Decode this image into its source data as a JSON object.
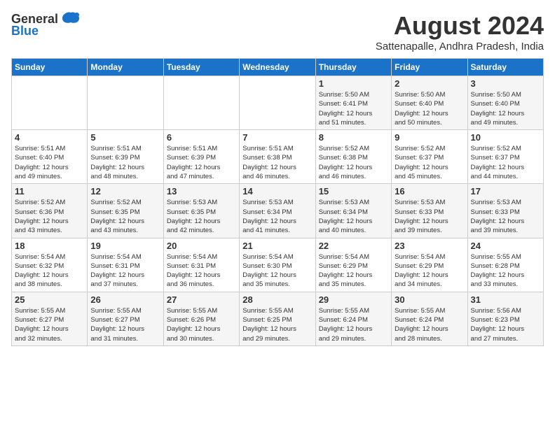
{
  "logo": {
    "general": "General",
    "blue": "Blue"
  },
  "header": {
    "month_year": "August 2024",
    "location": "Sattenapalle, Andhra Pradesh, India"
  },
  "days_of_week": [
    "Sunday",
    "Monday",
    "Tuesday",
    "Wednesday",
    "Thursday",
    "Friday",
    "Saturday"
  ],
  "weeks": [
    [
      {
        "day": "",
        "info": ""
      },
      {
        "day": "",
        "info": ""
      },
      {
        "day": "",
        "info": ""
      },
      {
        "day": "",
        "info": ""
      },
      {
        "day": "1",
        "info": "Sunrise: 5:50 AM\nSunset: 6:41 PM\nDaylight: 12 hours\nand 51 minutes."
      },
      {
        "day": "2",
        "info": "Sunrise: 5:50 AM\nSunset: 6:40 PM\nDaylight: 12 hours\nand 50 minutes."
      },
      {
        "day": "3",
        "info": "Sunrise: 5:50 AM\nSunset: 6:40 PM\nDaylight: 12 hours\nand 49 minutes."
      }
    ],
    [
      {
        "day": "4",
        "info": "Sunrise: 5:51 AM\nSunset: 6:40 PM\nDaylight: 12 hours\nand 49 minutes."
      },
      {
        "day": "5",
        "info": "Sunrise: 5:51 AM\nSunset: 6:39 PM\nDaylight: 12 hours\nand 48 minutes."
      },
      {
        "day": "6",
        "info": "Sunrise: 5:51 AM\nSunset: 6:39 PM\nDaylight: 12 hours\nand 47 minutes."
      },
      {
        "day": "7",
        "info": "Sunrise: 5:51 AM\nSunset: 6:38 PM\nDaylight: 12 hours\nand 46 minutes."
      },
      {
        "day": "8",
        "info": "Sunrise: 5:52 AM\nSunset: 6:38 PM\nDaylight: 12 hours\nand 46 minutes."
      },
      {
        "day": "9",
        "info": "Sunrise: 5:52 AM\nSunset: 6:37 PM\nDaylight: 12 hours\nand 45 minutes."
      },
      {
        "day": "10",
        "info": "Sunrise: 5:52 AM\nSunset: 6:37 PM\nDaylight: 12 hours\nand 44 minutes."
      }
    ],
    [
      {
        "day": "11",
        "info": "Sunrise: 5:52 AM\nSunset: 6:36 PM\nDaylight: 12 hours\nand 43 minutes."
      },
      {
        "day": "12",
        "info": "Sunrise: 5:52 AM\nSunset: 6:35 PM\nDaylight: 12 hours\nand 43 minutes."
      },
      {
        "day": "13",
        "info": "Sunrise: 5:53 AM\nSunset: 6:35 PM\nDaylight: 12 hours\nand 42 minutes."
      },
      {
        "day": "14",
        "info": "Sunrise: 5:53 AM\nSunset: 6:34 PM\nDaylight: 12 hours\nand 41 minutes."
      },
      {
        "day": "15",
        "info": "Sunrise: 5:53 AM\nSunset: 6:34 PM\nDaylight: 12 hours\nand 40 minutes."
      },
      {
        "day": "16",
        "info": "Sunrise: 5:53 AM\nSunset: 6:33 PM\nDaylight: 12 hours\nand 39 minutes."
      },
      {
        "day": "17",
        "info": "Sunrise: 5:53 AM\nSunset: 6:33 PM\nDaylight: 12 hours\nand 39 minutes."
      }
    ],
    [
      {
        "day": "18",
        "info": "Sunrise: 5:54 AM\nSunset: 6:32 PM\nDaylight: 12 hours\nand 38 minutes."
      },
      {
        "day": "19",
        "info": "Sunrise: 5:54 AM\nSunset: 6:31 PM\nDaylight: 12 hours\nand 37 minutes."
      },
      {
        "day": "20",
        "info": "Sunrise: 5:54 AM\nSunset: 6:31 PM\nDaylight: 12 hours\nand 36 minutes."
      },
      {
        "day": "21",
        "info": "Sunrise: 5:54 AM\nSunset: 6:30 PM\nDaylight: 12 hours\nand 35 minutes."
      },
      {
        "day": "22",
        "info": "Sunrise: 5:54 AM\nSunset: 6:29 PM\nDaylight: 12 hours\nand 35 minutes."
      },
      {
        "day": "23",
        "info": "Sunrise: 5:54 AM\nSunset: 6:29 PM\nDaylight: 12 hours\nand 34 minutes."
      },
      {
        "day": "24",
        "info": "Sunrise: 5:55 AM\nSunset: 6:28 PM\nDaylight: 12 hours\nand 33 minutes."
      }
    ],
    [
      {
        "day": "25",
        "info": "Sunrise: 5:55 AM\nSunset: 6:27 PM\nDaylight: 12 hours\nand 32 minutes."
      },
      {
        "day": "26",
        "info": "Sunrise: 5:55 AM\nSunset: 6:27 PM\nDaylight: 12 hours\nand 31 minutes."
      },
      {
        "day": "27",
        "info": "Sunrise: 5:55 AM\nSunset: 6:26 PM\nDaylight: 12 hours\nand 30 minutes."
      },
      {
        "day": "28",
        "info": "Sunrise: 5:55 AM\nSunset: 6:25 PM\nDaylight: 12 hours\nand 29 minutes."
      },
      {
        "day": "29",
        "info": "Sunrise: 5:55 AM\nSunset: 6:24 PM\nDaylight: 12 hours\nand 29 minutes."
      },
      {
        "day": "30",
        "info": "Sunrise: 5:55 AM\nSunset: 6:24 PM\nDaylight: 12 hours\nand 28 minutes."
      },
      {
        "day": "31",
        "info": "Sunrise: 5:56 AM\nSunset: 6:23 PM\nDaylight: 12 hours\nand 27 minutes."
      }
    ]
  ]
}
